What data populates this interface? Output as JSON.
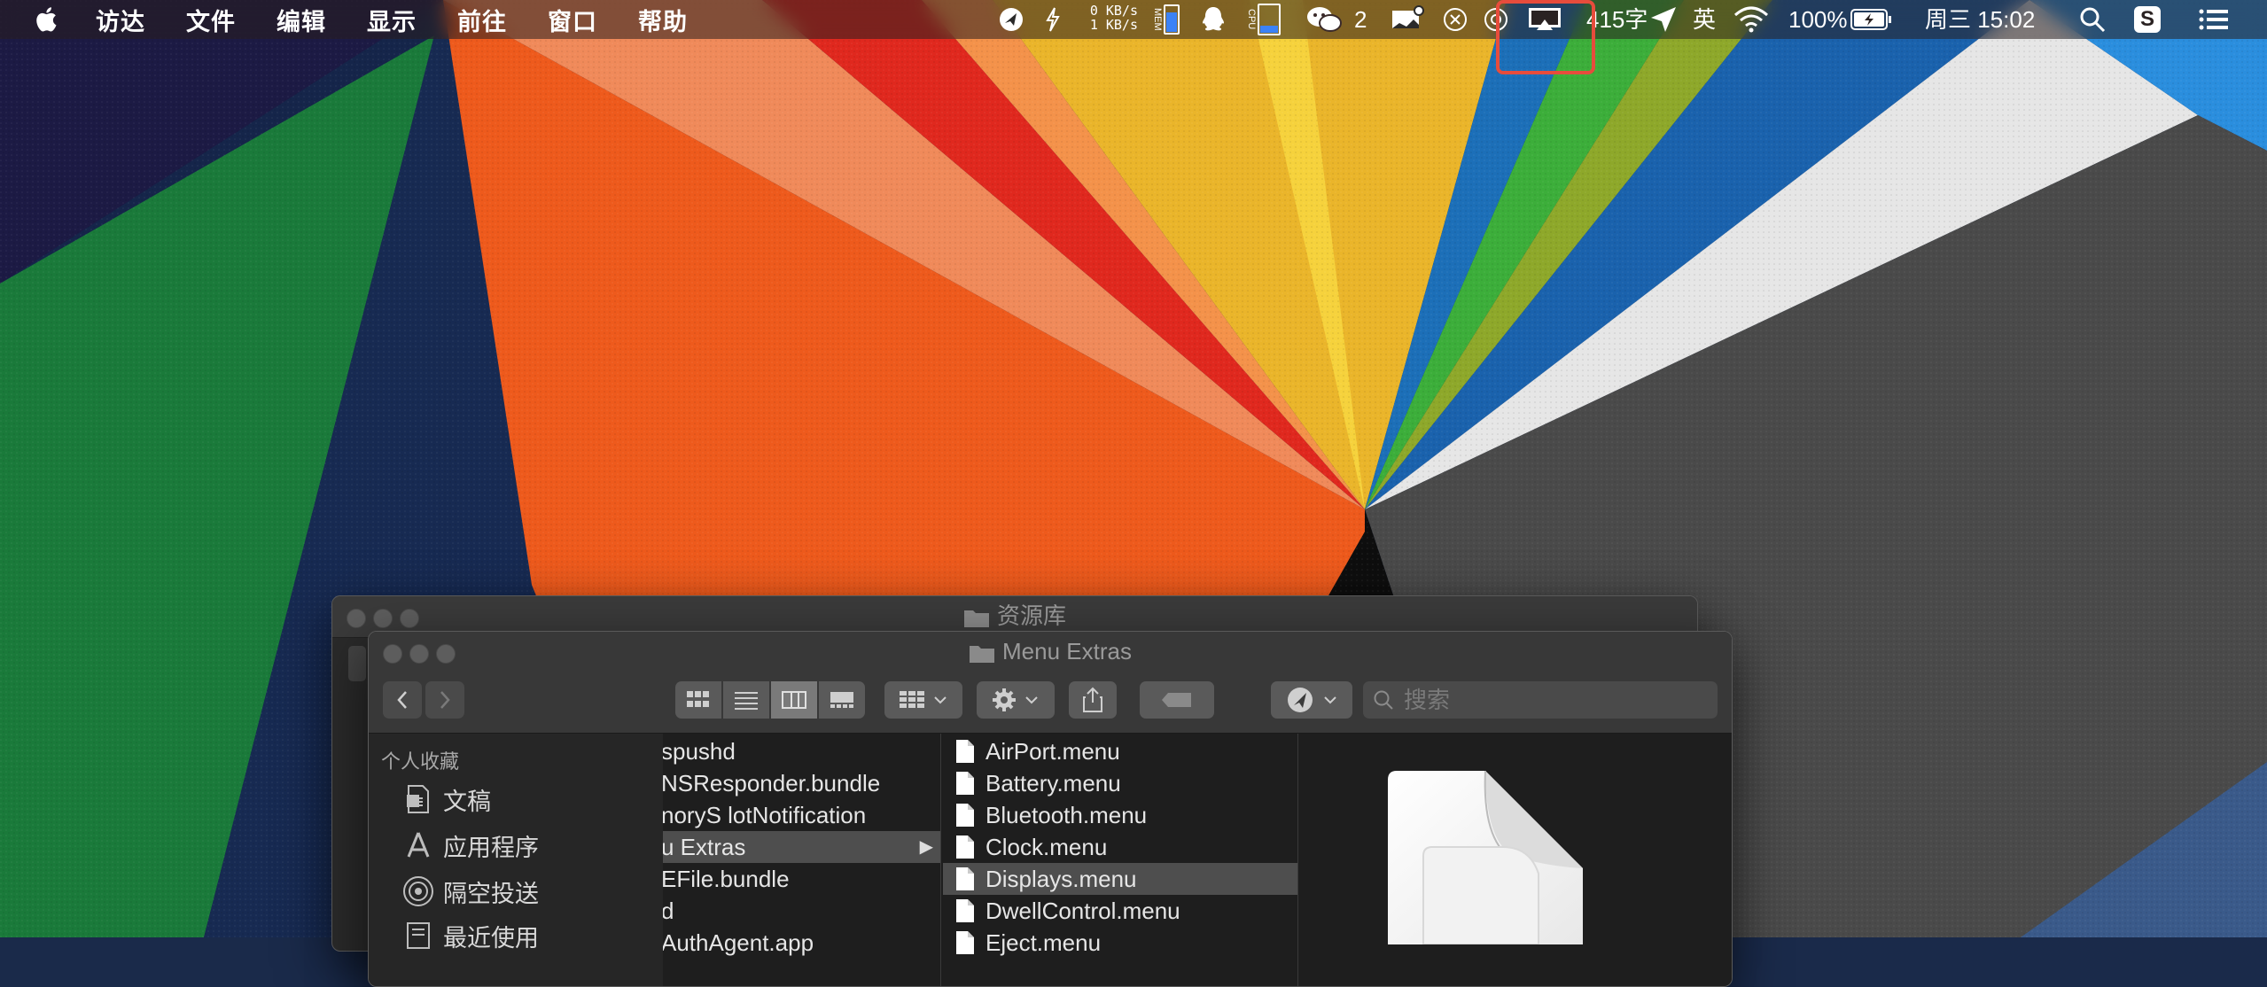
{
  "menubar": {
    "app_menus": [
      "访达",
      "文件",
      "编辑",
      "显示",
      "前往",
      "窗口",
      "帮助"
    ],
    "net_up": "0 KB/s",
    "net_down": "1 KB/s",
    "mem_label": "MEM",
    "cpu_label": "CPU",
    "wechat_badge": "2",
    "word_count": "415字",
    "input_method": "英",
    "battery": "100%",
    "datetime": "周三 15:02"
  },
  "back_window": {
    "title": "资源库"
  },
  "finder": {
    "title": "Menu Extras",
    "search_placeholder": "搜索",
    "sidebar": {
      "section": "个人收藏",
      "items": [
        {
          "label": "文稿",
          "icon": "document-icon"
        },
        {
          "label": "应用程序",
          "icon": "applications-icon"
        },
        {
          "label": "隔空投送",
          "icon": "airdrop-icon"
        },
        {
          "label": "最近使用",
          "icon": "recents-icon"
        }
      ]
    },
    "column1": [
      "spushd",
      "NSResponder.bundle",
      "noryS lotNotification",
      "u Extras",
      "EFile.bundle",
      "d",
      "AuthAgent.app"
    ],
    "column1_selected": 3,
    "column2": [
      "AirPort.menu",
      "Battery.menu",
      "Bluetooth.menu",
      "Clock.menu",
      "Displays.menu",
      "DwellControl.menu",
      "Eject.menu"
    ],
    "column2_selected": 4
  }
}
